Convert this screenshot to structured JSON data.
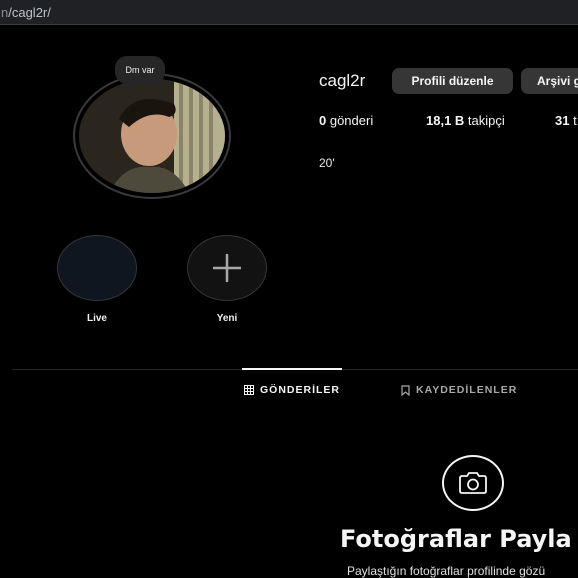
{
  "browser": {
    "url_prefix": "n",
    "url_path": "/cagl2r/"
  },
  "profile": {
    "note": "Dm var",
    "username": "cagl2r",
    "edit_profile_label": "Profili düzenle",
    "archive_label": "Arşivi g",
    "bio": "20'"
  },
  "stats": {
    "posts_count": "0",
    "posts_label": " gönderi",
    "followers_count": "18,1 B",
    "followers_label": " takipçi",
    "following_count": "31",
    "following_label": " t"
  },
  "highlights": [
    {
      "label": "Live"
    },
    {
      "label": "Yeni"
    }
  ],
  "tabs": {
    "posts": "GÖNDERİLER",
    "saved": "KAYDEDİLENLER"
  },
  "empty_state": {
    "title": "Fotoğraflar Payla",
    "subtitle": "Paylaştığın fotoğraflar profilinde gözü",
    "icon": "camera-icon"
  },
  "colors": {
    "background": "#000000",
    "button_bg": "#363636",
    "text": "#f5f5f5",
    "muted": "#a8a8a8"
  }
}
